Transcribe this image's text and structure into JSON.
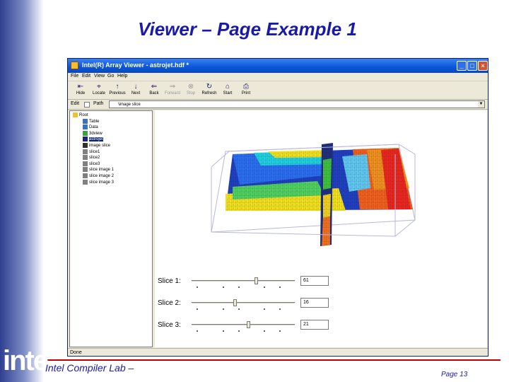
{
  "slide": {
    "title": "Viewer – Page Example 1",
    "footer_left": "Intel Compiler Lab –",
    "footer_right": "Page 13",
    "logo_text": "inte"
  },
  "window": {
    "title": "Intel(R) Array Viewer - astrojet.hdf *",
    "controls": [
      "_",
      "□",
      "×"
    ]
  },
  "menu": [
    "File",
    "Edit",
    "View",
    "Go",
    "Help"
  ],
  "toolbar": [
    {
      "label": "Hide",
      "icon": "hide-icon",
      "glyph": "⇤",
      "enabled": true
    },
    {
      "label": "Locate",
      "icon": "locate-icon",
      "glyph": "⌖",
      "enabled": true
    },
    {
      "label": "Previous",
      "icon": "previous-icon",
      "glyph": "↑",
      "enabled": true
    },
    {
      "label": "Next",
      "icon": "next-icon",
      "glyph": "↓",
      "enabled": true
    },
    {
      "label": "Back",
      "icon": "back-icon",
      "glyph": "⇐",
      "enabled": true
    },
    {
      "label": "Forward",
      "icon": "forward-icon",
      "glyph": "⇒",
      "enabled": false
    },
    {
      "label": "Stop",
      "icon": "stop-icon",
      "glyph": "⊗",
      "enabled": false
    },
    {
      "label": "Refresh",
      "icon": "refresh-icon",
      "glyph": "↻",
      "enabled": true
    },
    {
      "label": "Start",
      "icon": "start-icon",
      "glyph": "⌂",
      "enabled": true
    },
    {
      "label": "Print",
      "icon": "print-icon",
      "glyph": "⎙",
      "enabled": true
    }
  ],
  "pathbar": {
    "edit_label": "Edit",
    "path_label": "Path",
    "path_value": "\\image slice"
  },
  "tree": {
    "items": [
      {
        "label": "Root",
        "icon": "folder-icon",
        "level": 0,
        "selected": false
      },
      {
        "label": "Table",
        "icon": "table-icon",
        "level": 1,
        "selected": false
      },
      {
        "label": "Data",
        "icon": "data-icon",
        "level": 1,
        "selected": false
      },
      {
        "label": "3dview",
        "icon": "3d-view-icon",
        "level": 1,
        "selected": false
      },
      {
        "label": "astrojet",
        "icon": "dataset-icon",
        "level": 1,
        "selected": true
      },
      {
        "label": "image slice",
        "icon": "image-icon",
        "level": 1,
        "selected": false
      },
      {
        "label": "slice1",
        "icon": "slice-icon",
        "level": 1,
        "selected": false
      },
      {
        "label": "slice2",
        "icon": "slice-icon",
        "level": 1,
        "selected": false
      },
      {
        "label": "slice3",
        "icon": "slice-icon",
        "level": 1,
        "selected": false
      },
      {
        "label": "slice image 1",
        "icon": "slice-icon",
        "level": 1,
        "selected": false
      },
      {
        "label": "slice image 2",
        "icon": "slice-icon",
        "level": 1,
        "selected": false
      },
      {
        "label": "slice image 3",
        "icon": "slice-icon",
        "level": 1,
        "selected": false
      }
    ]
  },
  "sliders": [
    {
      "label": "Slice 1:",
      "value": "61",
      "position": 0.62
    },
    {
      "label": "Slice 2:",
      "value": "16",
      "position": 0.42
    },
    {
      "label": "Slice 3:",
      "value": "21",
      "position": 0.55
    }
  ],
  "status": "Done",
  "colors": {
    "title": "#1a1aa8",
    "accent_red": "#c00000",
    "titlebar_blue": "#0a56d8"
  }
}
